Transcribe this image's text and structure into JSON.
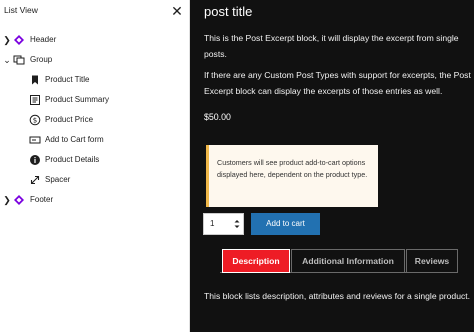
{
  "list_view": {
    "title": "List View",
    "close_icon": "close-icon",
    "items": [
      {
        "label": "Header",
        "icon": "template-part-icon",
        "expander": "chevron-right-icon"
      },
      {
        "label": "Group",
        "icon": "group-icon",
        "expander": "chevron-down-icon"
      },
      {
        "label": "Product Title",
        "icon": "bookmark-icon"
      },
      {
        "label": "Product Summary",
        "icon": "summary-icon"
      },
      {
        "label": "Product Price",
        "icon": "price-icon"
      },
      {
        "label": "Add to Cart form",
        "icon": "cart-form-icon"
      },
      {
        "label": "Product Details",
        "icon": "info-icon"
      },
      {
        "label": "Spacer",
        "icon": "spacer-icon"
      },
      {
        "label": "Footer",
        "icon": "template-part-icon",
        "expander": "chevron-right-icon"
      }
    ]
  },
  "canvas": {
    "post_title": "post title",
    "excerpt_1": "This is the Post Excerpt block, it will display the excerpt from single posts.",
    "excerpt_2": "If there are any Custom Post Types with support for excerpts, the Post Excerpt block can display the excerpts of those entries as well.",
    "price": "$50.00",
    "notice": "Customers will see product add-to-cart options displayed here, dependent on the product type.",
    "quantity": "1",
    "add_to_cart": "Add to cart",
    "tabs": [
      "Description",
      "Additional Information",
      "Reviews"
    ],
    "tab_content": "This block lists description, attributes and reviews for a single product."
  },
  "colors": {
    "canvas_bg": "#111111",
    "template_part_icon": "#7a00df",
    "notice_bg": "#fef8ee",
    "notice_border": "#f0b849",
    "button_blue": "#2271b1",
    "tab_active": "#ee1c25"
  }
}
